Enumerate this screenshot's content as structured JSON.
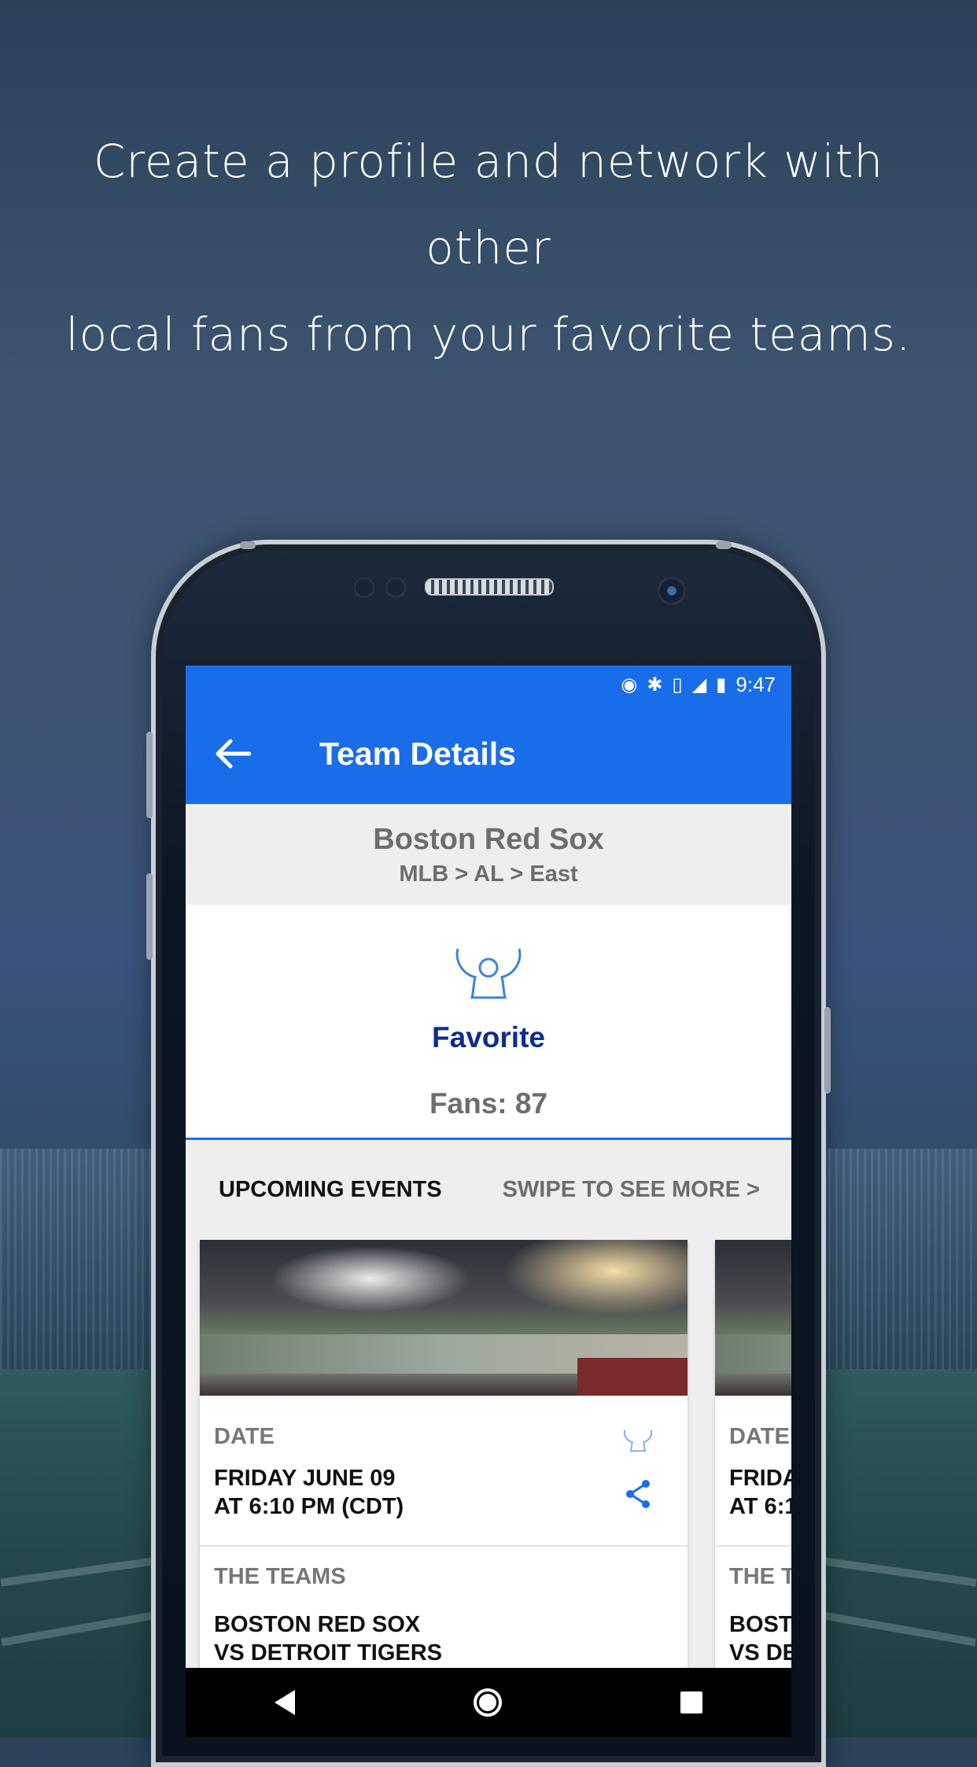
{
  "promo": {
    "line1": "Create a profile and network with other",
    "line2": "local fans from your favorite teams."
  },
  "status_bar": {
    "time": "9:47",
    "icons": [
      "location-icon",
      "bluetooth-icon",
      "vibrate-icon",
      "lte-signal-icon",
      "battery-charging-icon"
    ]
  },
  "app_bar": {
    "title": "Team Details",
    "back_icon": "arrow-left-icon"
  },
  "team": {
    "name": "Boston Red Sox",
    "path": "MLB > AL > East"
  },
  "favorite": {
    "label": "Favorite",
    "icon": "cheering-fan-icon",
    "fans_text": "Fans: 87"
  },
  "events": {
    "heading": "UPCOMING EVENTS",
    "swipe_hint": "SWIPE TO SEE MORE >",
    "cards": [
      {
        "date_label": "DATE",
        "date_line1": "FRIDAY JUNE 09",
        "date_line2": "AT 6:10 PM (CDT)",
        "teams_label": "THE TEAMS",
        "teams_line1": "BOSTON RED SOX",
        "teams_line2": "VS DETROIT TIGERS"
      },
      {
        "date_label": "DATE",
        "date_line1": "FRIDA",
        "date_line2": "AT 6:1",
        "teams_label": "THE T",
        "teams_line1": "BOSTO",
        "teams_line2": "VS DET"
      }
    ]
  },
  "colors": {
    "primary": "#1a6de8",
    "favorite_text": "#0e2d8c",
    "muted_text": "#6d6d6d"
  }
}
